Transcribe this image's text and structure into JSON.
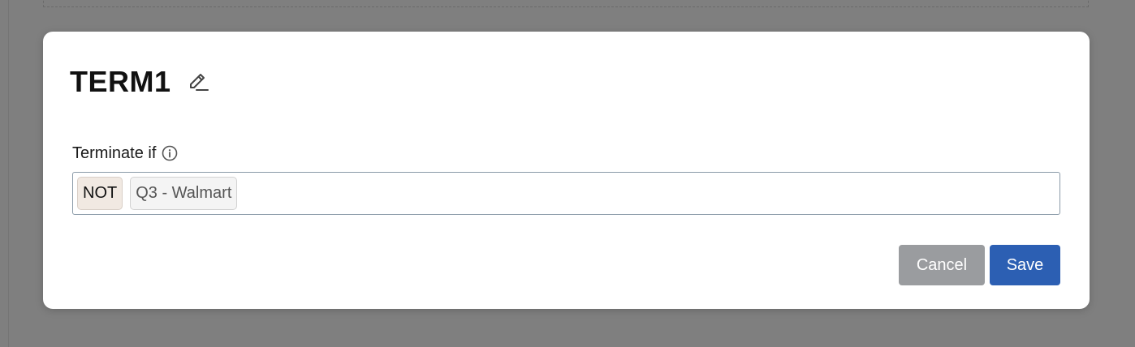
{
  "dialog": {
    "title": "TERM1",
    "edit_icon": "pencil-edit-icon",
    "field_label": "Terminate if",
    "info_icon": "info-circle-icon",
    "chips": [
      {
        "label": "NOT",
        "kind": "operator"
      },
      {
        "label": "Q3 - Walmart",
        "kind": "condition"
      }
    ],
    "buttons": {
      "cancel": "Cancel",
      "save": "Save"
    }
  },
  "colors": {
    "overlay": "#7f7f7f",
    "save_button": "#2c5fb3",
    "cancel_button": "#9a9c9f",
    "not_chip": "#f1e9e2",
    "condition_chip": "#f4f4f4"
  }
}
